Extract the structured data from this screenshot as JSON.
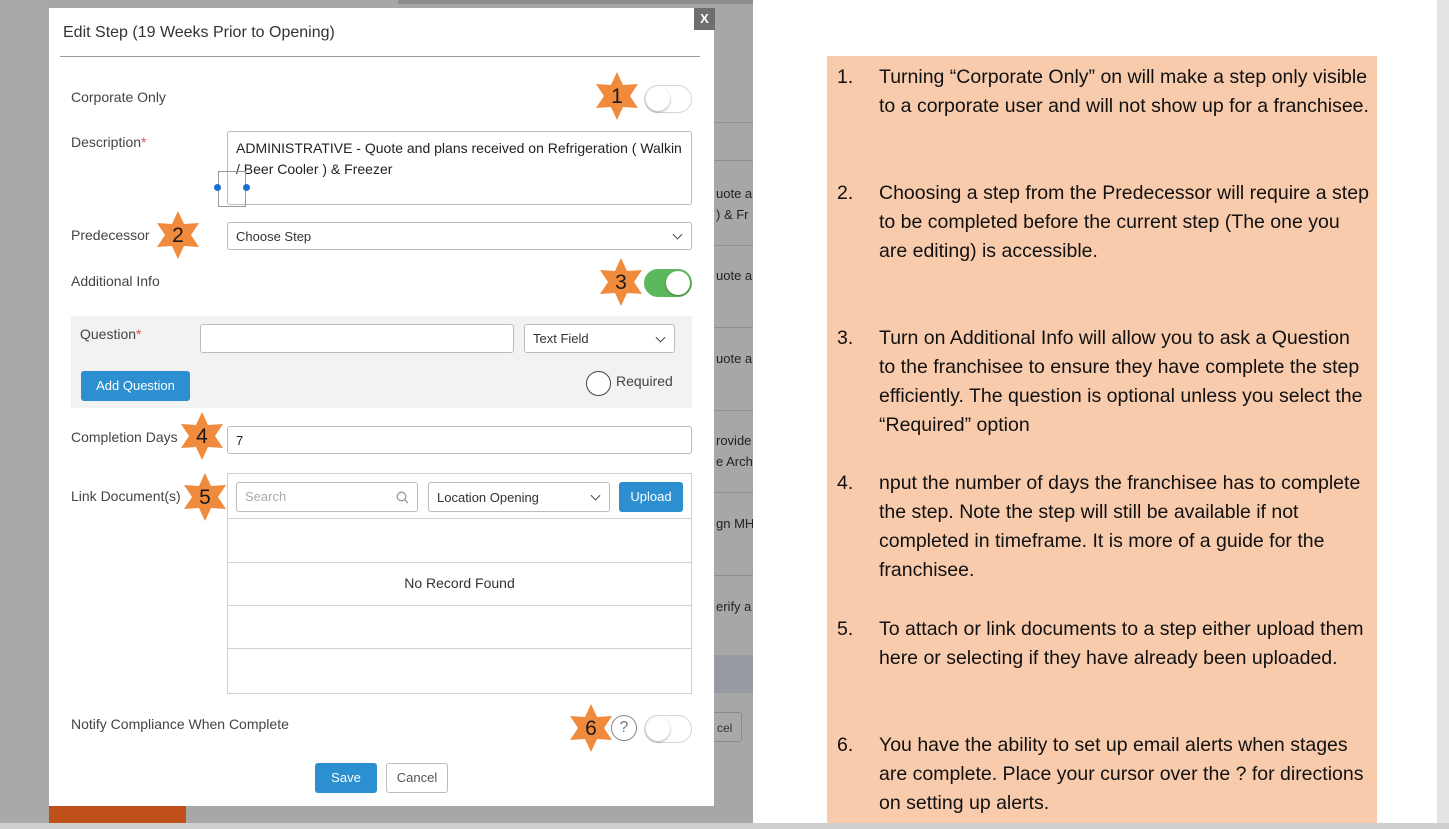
{
  "modal": {
    "title": "Edit Step (19 Weeks Prior to Opening)",
    "close_label": "X",
    "corporate_only_label": "Corporate Only",
    "corporate_only_on": false,
    "description_label": "Description",
    "required_marker": "*",
    "description_value": "ADMINISTRATIVE - Quote and plans received on Refrigeration ( Walkin / Beer Cooler ) & Freezer",
    "predecessor_label": "Predecessor",
    "predecessor_value": "Choose Step",
    "additional_info_label": "Additional Info",
    "additional_info_on": true,
    "question_label": "Question",
    "question_value": "",
    "question_type_value": "Text Field",
    "add_question_label": "Add Question",
    "required_label": "Required",
    "completion_days_label": "Completion Days",
    "completion_days_value": "7",
    "link_documents_label": "Link Document(s)",
    "search_placeholder": "Search",
    "location_select_value": "Location Opening",
    "upload_label": "Upload",
    "no_record_label": "No Record Found",
    "notify_label": "Notify Compliance When Complete",
    "notify_on": false,
    "help_glyph": "?",
    "save_label": "Save",
    "cancel_label": "Cancel"
  },
  "badges": [
    "1",
    "2",
    "3",
    "4",
    "5",
    "6"
  ],
  "background": {
    "row_texts": [
      "uote a",
      ") & Fr",
      "uote a",
      "uote a",
      "rovide",
      "e Arch",
      "gn MH",
      "erify a"
    ],
    "cancel_fragment": "cel"
  },
  "notes": [
    {
      "num": "1.",
      "text": "Turning “Corporate Only” on will make a step only visible to a corporate user and will  not show up for a franchisee."
    },
    {
      "num": "2.",
      "text": "Choosing a step from the Predecessor will require a step to be completed before the current step (The one you are editing) is accessible."
    },
    {
      "num": "3.",
      "text": "Turn on Additional Info will allow you to ask a Question to the franchisee to ensure they have complete the step efficiently.  The question is optional unless you select the “Required” option"
    },
    {
      "num": "4.",
      "text": "nput the number of days the franchisee has to complete the step. Note the step will still be available if not completed in timeframe. It is more of a guide for the franchisee."
    },
    {
      "num": "5.",
      "text": "To attach or link documents to a step either upload them here or selecting if they have already been uploaded."
    },
    {
      "num": "6.",
      "text": "You have the ability to set up email alerts when stages are complete. Place your cursor over the ? for directions on setting up alerts."
    }
  ],
  "colors": {
    "primary_button": "#2b8fd0",
    "toggle_on": "#5cb85c",
    "badge_orange": "#f08a3c",
    "notes_background": "#f8cbad",
    "required_marker": "#d9534f"
  },
  "icons": {
    "close": "close-icon",
    "search": "search-icon",
    "chevron": "chevron-down-icon",
    "help": "help-icon",
    "badge": "star-badge-icon"
  }
}
